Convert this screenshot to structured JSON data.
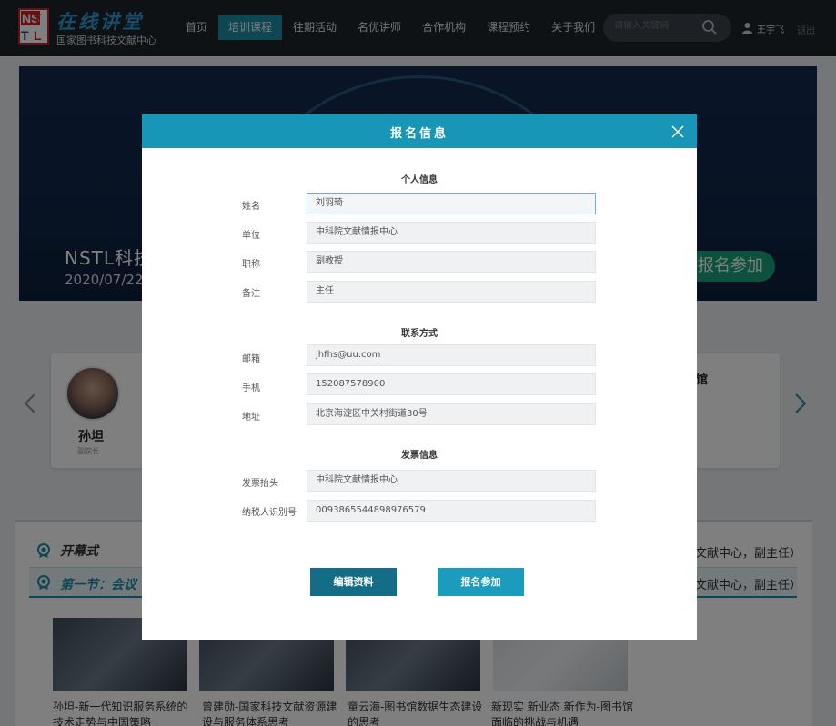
{
  "header": {
    "logo_letters": [
      "NS",
      "T",
      "T",
      "L"
    ],
    "logo_title": "在线讲堂",
    "logo_subtitle": "国家图书科技文献中心",
    "nav": [
      "首页",
      "培训课程",
      "往期活动",
      "名优讲师",
      "合作机构",
      "课程预约",
      "关于我们"
    ],
    "active_nav": "培训课程",
    "search_placeholder": "请输入关键词",
    "user_name": "王宇飞",
    "logout": "退出"
  },
  "banner": {
    "title": "NSTL科技",
    "date": "2020/07/22",
    "cta": "报名参加"
  },
  "speaker": {
    "name": "孙坦",
    "role": "副院长",
    "right_title": "馆"
  },
  "agenda": {
    "opening": "开幕式",
    "opening_right": "文献中心，副主任）",
    "section1": "第一节：会议",
    "section1_right": "文献中心，副主任）",
    "videos": [
      "孙坦-新一代知识服务系统的技术走势与中国策略",
      "曾建勋-国家科技文献资源建设与服务体系思考",
      "童云海-图书馆数据生态建设的思考",
      "新现实 新业态 新作为-图书馆面临的挑战与机遇"
    ]
  },
  "modal": {
    "title": "报名信息",
    "sections": {
      "personal": "个人信息",
      "contact": "联系方式",
      "invoice": "发票信息"
    },
    "fields": {
      "name": {
        "label": "姓名",
        "value": "刘羽琦"
      },
      "unit": {
        "label": "单位",
        "value": "中科院文献情报中心"
      },
      "title": {
        "label": "职称",
        "value": "副教授"
      },
      "remark": {
        "label": "备注",
        "value": "主任"
      },
      "email": {
        "label": "邮箱",
        "value": "jhfhs@uu.com"
      },
      "phone": {
        "label": "手机",
        "value": "152087578900"
      },
      "address": {
        "label": "地址",
        "value": "北京海淀区中关村街道30号"
      },
      "invoice_title": {
        "label": "发票抬头",
        "value": "中科院文献情报中心"
      },
      "tax_id": {
        "label": "纳税人识别号",
        "value": "0093865544898976579"
      }
    },
    "edit_button": "编辑资料",
    "submit_button": "报名参加"
  },
  "colors": {
    "accent": "#1796b7",
    "header_bg": "#1f252b",
    "edit_button": "#146d87",
    "submit_button": "#1b9cbc"
  }
}
